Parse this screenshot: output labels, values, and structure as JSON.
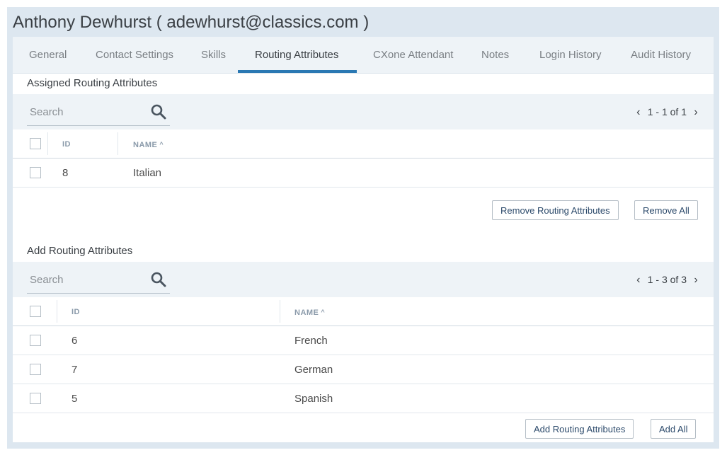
{
  "header": {
    "title": "Anthony Dewhurst ( adewhurst@classics.com )"
  },
  "tabs": [
    {
      "label": "General"
    },
    {
      "label": "Contact Settings"
    },
    {
      "label": "Skills"
    },
    {
      "label": "Routing Attributes",
      "active": true
    },
    {
      "label": "CXone Attendant"
    },
    {
      "label": "Notes"
    },
    {
      "label": "Login History"
    },
    {
      "label": "Audit History"
    }
  ],
  "assigned": {
    "title": "Assigned Routing Attributes",
    "search_placeholder": "Search",
    "pagination": "1 - 1 of 1",
    "columns": {
      "id": "ID",
      "name": "NAME"
    },
    "rows": [
      {
        "id": "8",
        "name": "Italian"
      }
    ],
    "remove_label": "Remove Routing Attributes",
    "remove_all_label": "Remove All"
  },
  "available": {
    "title": "Add Routing Attributes",
    "search_placeholder": "Search",
    "pagination": "1 - 3 of 3",
    "columns": {
      "id": "ID",
      "name": "NAME"
    },
    "rows": [
      {
        "id": "6",
        "name": "French"
      },
      {
        "id": "7",
        "name": "German"
      },
      {
        "id": "5",
        "name": "Spanish"
      }
    ],
    "add_label": "Add Routing Attributes",
    "add_all_label": "Add All"
  },
  "colors": {
    "accent": "#2a78b3",
    "toolbar_bg": "#eef3f7",
    "frame_bg": "#dde7f0"
  },
  "icons": {
    "search": "search-icon",
    "prev": "chevron-left-icon",
    "next": "chevron-right-icon",
    "sort": "sort-ascending-icon"
  }
}
